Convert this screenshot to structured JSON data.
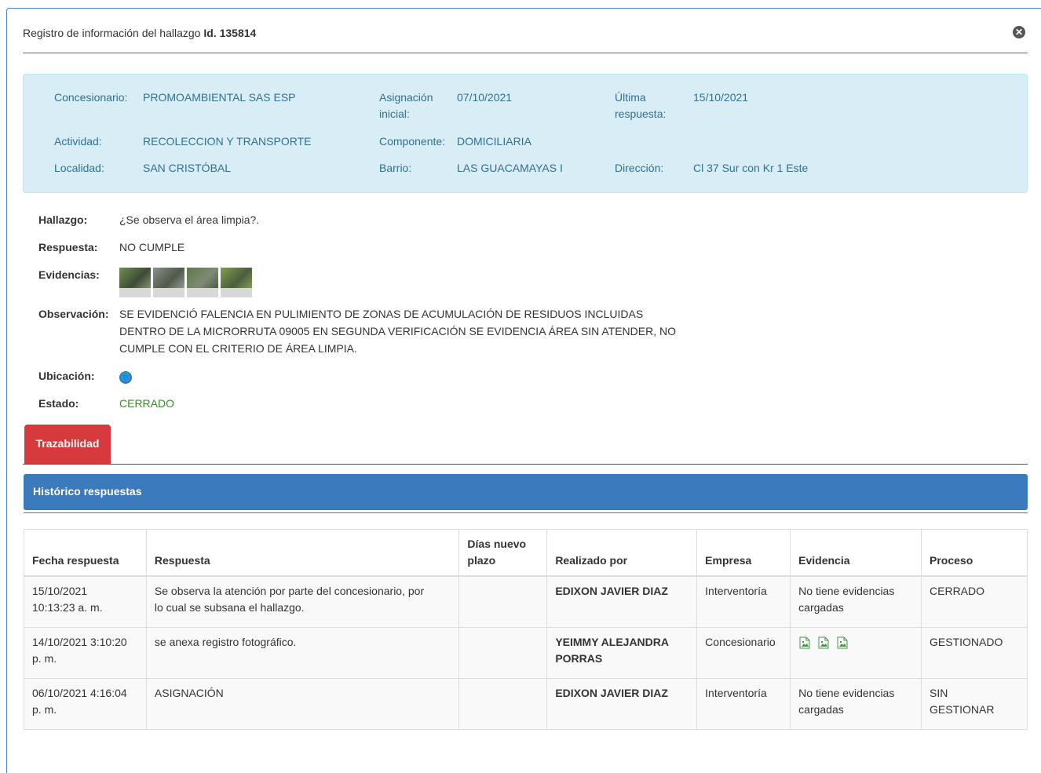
{
  "header": {
    "title_prefix": "Registro de información del hallazgo",
    "title_id": "Id. 135814"
  },
  "info": {
    "concesionario_label": "Concesionario:",
    "concesionario_value": "PROMOAMBIENTAL SAS ESP",
    "asignacion_label_1": "Asignación",
    "asignacion_label_2": "inicial:",
    "asignacion_value": "07/10/2021",
    "ultima_label_1": "Última",
    "ultima_label_2": "respuesta:",
    "ultima_value": "15/10/2021",
    "actividad_label": "Actividad:",
    "actividad_value": "RECOLECCION Y TRANSPORTE",
    "componente_label": "Componente:",
    "componente_value": "DOMICILIARIA",
    "localidad_label": "Localidad:",
    "localidad_value": "SAN CRISTÓBAL",
    "barrio_label": "Barrio:",
    "barrio_value": "LAS GUACAMAYAS I",
    "direccion_label": "Dirección:",
    "direccion_value": "Cl 37 Sur con Kr 1 Este"
  },
  "details": {
    "hallazgo_label": "Hallazgo:",
    "hallazgo_value": "¿Se observa el área limpia?.",
    "respuesta_label": "Respuesta:",
    "respuesta_value": "NO CUMPLE",
    "evidencias_label": "Evidencias:",
    "observacion_label": "Observación:",
    "observacion_line1": "SE EVIDENCIÓ FALENCIA EN PULIMIENTO DE ZONAS DE ACUMULACIÓN DE RESIDUOS INCLUIDAS",
    "observacion_line2": "DENTRO DE LA MICRORRUTA 09005 EN SEGUNDA VERIFICACIÓN SE EVIDENCIA ÁREA SIN ATENDER, NO",
    "observacion_line3": "CUMPLE CON EL CRITERIO DE ÁREA LIMPIA.",
    "ubicacion_label": "Ubicación:",
    "estado_label": "Estado:",
    "estado_value": "CERRADO"
  },
  "tabs": {
    "trazabilidad": "Trazabilidad"
  },
  "panel": {
    "title": "Histórico respuestas"
  },
  "table": {
    "headers": {
      "fecha": "Fecha respuesta",
      "respuesta": "Respuesta",
      "dias_1": "Días nuevo",
      "dias_2": "plazo",
      "realizado": "Realizado por",
      "empresa": "Empresa",
      "evidencia": "Evidencia",
      "proceso": "Proceso"
    },
    "rows": [
      {
        "fecha_1": "15/10/2021",
        "fecha_2": "10:13:23 a. m.",
        "respuesta_1": "Se observa la atención por parte del concesionario, por",
        "respuesta_2": "lo cual se subsana el hallazgo.",
        "dias": "",
        "realizado_1": "EDIXON JAVIER DIAZ",
        "realizado_2": "",
        "empresa": "Interventoría",
        "evidencia_1": "No tiene evidencias",
        "evidencia_2": "cargadas",
        "proceso_1": "CERRADO",
        "proceso_2": ""
      },
      {
        "fecha_1": "14/10/2021 3:10:20",
        "fecha_2": "p. m.",
        "respuesta_1": "se anexa registro fotográfico.",
        "respuesta_2": "",
        "dias": "",
        "realizado_1": "YEIMMY ALEJANDRA",
        "realizado_2": "PORRAS",
        "empresa": "Concesionario",
        "evidencia_1": "",
        "evidencia_2": "",
        "proceso_1": "GESTIONADO",
        "proceso_2": ""
      },
      {
        "fecha_1": "06/10/2021 4:16:04",
        "fecha_2": "p. m.",
        "respuesta_1": "ASIGNACIÓN",
        "respuesta_2": "",
        "dias": "",
        "realizado_1": "EDIXON JAVIER DIAZ",
        "realizado_2": "",
        "empresa": "Interventoría",
        "evidencia_1": "No tiene evidencias",
        "evidencia_2": "cargadas",
        "proceso_1": "SIN",
        "proceso_2": "GESTIONAR"
      }
    ]
  },
  "icons": {
    "close": "close-circle-icon",
    "globe": "globe-icon",
    "image_file": "image-file-icon"
  },
  "colors": {
    "tab_active": "#d63a3d",
    "panel_header": "#3a7abd",
    "info_bg": "#d9edf7",
    "estado_green": "#3c8a2e"
  }
}
